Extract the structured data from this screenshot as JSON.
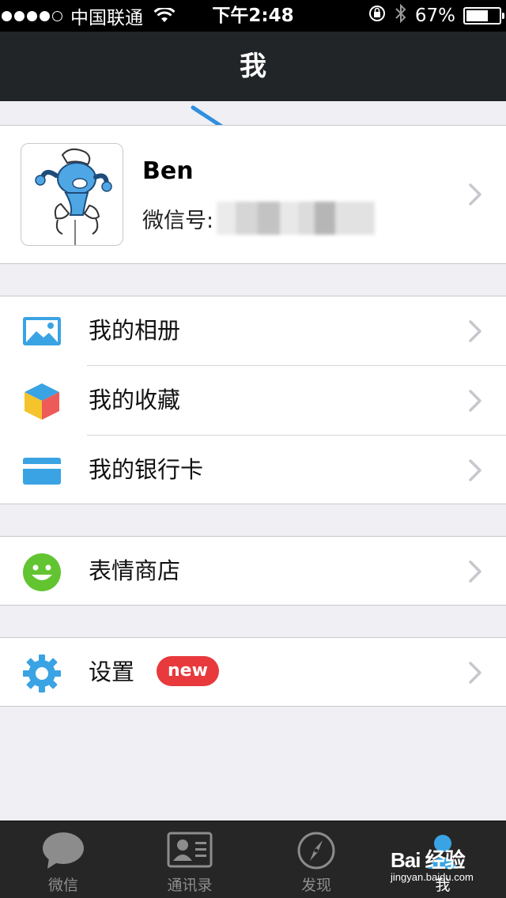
{
  "status_bar": {
    "carrier": "中国联通",
    "time": "下午2:48",
    "battery": "67%",
    "battery_level": 0.67,
    "signal_bars_filled": 4,
    "signal_bars_total": 5
  },
  "nav": {
    "title": "我"
  },
  "profile": {
    "name": "Ben",
    "wechat_id_label": "微信号:"
  },
  "menu_group_1": [
    {
      "label": "我的相册",
      "icon": "photo-album-icon"
    },
    {
      "label": "我的收藏",
      "icon": "favorites-cube-icon"
    },
    {
      "label": "我的银行卡",
      "icon": "bank-card-icon"
    }
  ],
  "menu_group_2": [
    {
      "label": "表情商店",
      "icon": "smiley-icon"
    }
  ],
  "menu_group_3": [
    {
      "label": "设置",
      "icon": "gear-icon",
      "badge": "new"
    }
  ],
  "tabbar": [
    {
      "label": "微信",
      "icon": "chat-bubble-icon"
    },
    {
      "label": "通讯录",
      "icon": "contacts-icon"
    },
    {
      "label": "发现",
      "icon": "compass-icon"
    },
    {
      "label": "我",
      "icon": "person-icon",
      "active": true
    }
  ],
  "watermark": {
    "brand": "Bai 经验",
    "url": "jingyan.baidu.com"
  },
  "colors": {
    "nav_bg": "#212527",
    "tab_bg": "#262626",
    "accent_blue": "#3aa3e3",
    "badge_red": "#e8393d",
    "smiley_green": "#62c431"
  }
}
